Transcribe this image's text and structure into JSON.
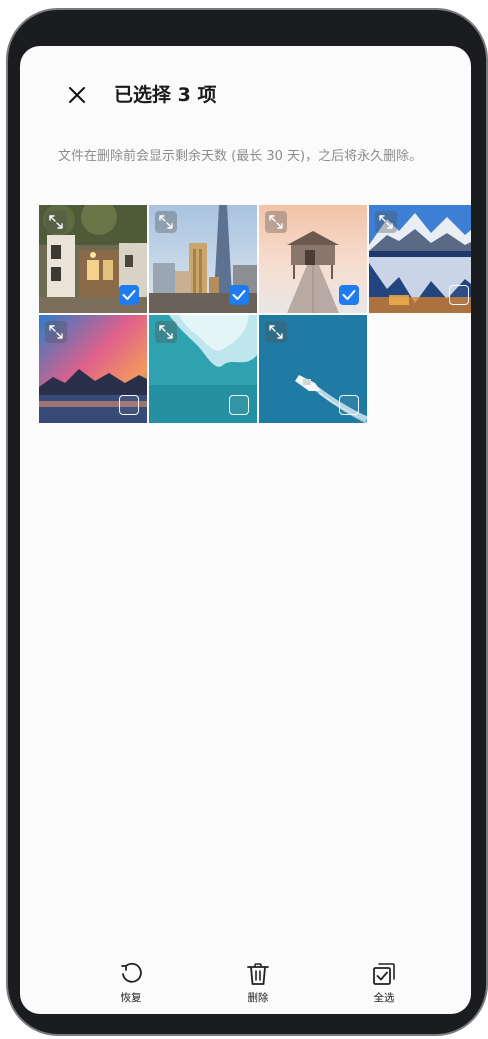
{
  "header": {
    "title": "已选择 3 项"
  },
  "notice": "文件在删除前会显示剩余天数 (最长 30 天)，之后将永久删除。",
  "photos": [
    {
      "subject": "street-house",
      "selected": true
    },
    {
      "subject": "city-skyline",
      "selected": true
    },
    {
      "subject": "pier-hut",
      "selected": true
    },
    {
      "subject": "mountain-lake",
      "selected": false
    },
    {
      "subject": "sunset-lake",
      "selected": false
    },
    {
      "subject": "glacier-water",
      "selected": false
    },
    {
      "subject": "boat-sea",
      "selected": false
    }
  ],
  "actions": {
    "restore": "恢复",
    "delete": "删除",
    "select_all": "全选"
  },
  "colors": {
    "accent": "#1e7bf0",
    "text": "#1a1a1a",
    "muted": "#8c8c8c"
  }
}
